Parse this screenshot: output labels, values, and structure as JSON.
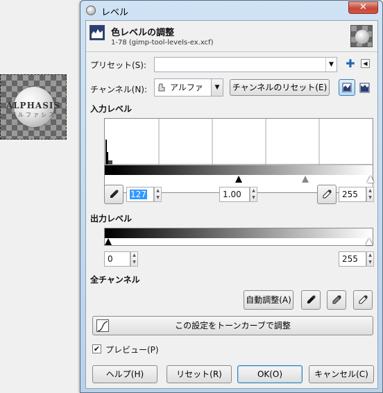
{
  "canvas": {
    "brand": "ALPHASIS",
    "brand_sub": "アルファシス"
  },
  "window": {
    "title": "レベル",
    "close_glyph": "✕"
  },
  "header": {
    "title": "色レベルの調整",
    "subtitle": "1-78 (gimp-tool-levels-ex.xcf)"
  },
  "preset": {
    "label": "プリセット(S):",
    "value": "",
    "add_icon": "plus-icon",
    "menu_icon": "arrow-left-icon"
  },
  "channel": {
    "label": "チャンネル(N):",
    "value": "アルファ",
    "reset_button": "チャンネルのリセット(E)"
  },
  "input_levels": {
    "heading": "入力レベル",
    "black": "127",
    "gamma": "1.00",
    "white": "255",
    "black_marker": 127,
    "gray_marker": 190,
    "white_marker": 255
  },
  "output_levels": {
    "heading": "出力レベル",
    "low": "0",
    "high": "255"
  },
  "all_channels": {
    "heading": "全チャンネル",
    "auto_button": "自動調整(A)"
  },
  "curves_button": "この設定をトーンカーブで調整",
  "preview": {
    "label": "プレビュー(P)",
    "checked": true
  },
  "buttons": {
    "help": "ヘルプ(H)",
    "reset": "リセット(R)",
    "ok": "OK(O)",
    "cancel": "キャンセル(C)"
  },
  "colors": {
    "accent": "#3c7fb1",
    "selection": "#3399ff",
    "title_close": "#c7483a"
  }
}
